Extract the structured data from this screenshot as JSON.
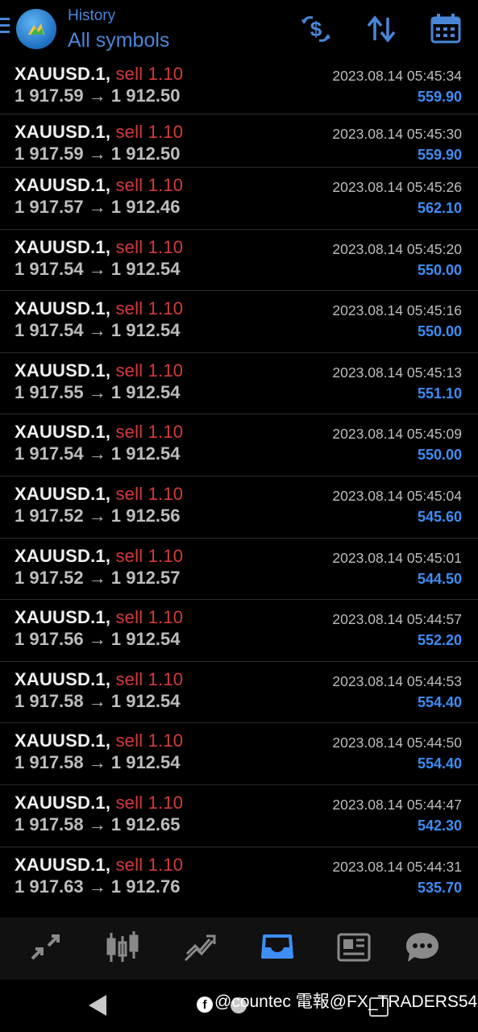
{
  "header": {
    "title": "History",
    "subtitle": "All symbols",
    "icons": [
      "menu-icon",
      "metatrader-logo-icon",
      "dollar-refresh-icon",
      "sort-arrows-icon",
      "calendar-icon"
    ],
    "accent_color": "#4a86d8"
  },
  "colors": {
    "sell": "#d63a3a",
    "profit": "#3d8ef5",
    "text": "#f2f2f2",
    "muted": "#bdbdbd"
  },
  "trades": [
    {
      "symbol": "XAUUSD.1,",
      "side": "sell 1.10",
      "prices": "1 917.59 → 1 912.50",
      "time": "2023.08.14 05:45:34",
      "profit": "559.90"
    },
    {
      "symbol": "XAUUSD.1,",
      "side": "sell 1.10",
      "prices": "1 917.59 → 1 912.50",
      "time": "2023.08.14 05:45:30",
      "profit": "559.90"
    },
    {
      "symbol": "XAUUSD.1,",
      "side": "sell 1.10",
      "prices": "1 917.57 → 1 912.46",
      "time": "2023.08.14 05:45:26",
      "profit": "562.10"
    },
    {
      "symbol": "XAUUSD.1,",
      "side": "sell 1.10",
      "prices": "1 917.54 → 1 912.54",
      "time": "2023.08.14 05:45:20",
      "profit": "550.00"
    },
    {
      "symbol": "XAUUSD.1,",
      "side": "sell 1.10",
      "prices": "1 917.54 → 1 912.54",
      "time": "2023.08.14 05:45:16",
      "profit": "550.00"
    },
    {
      "symbol": "XAUUSD.1,",
      "side": "sell 1.10",
      "prices": "1 917.55 → 1 912.54",
      "time": "2023.08.14 05:45:13",
      "profit": "551.10"
    },
    {
      "symbol": "XAUUSD.1,",
      "side": "sell 1.10",
      "prices": "1 917.54 → 1 912.54",
      "time": "2023.08.14 05:45:09",
      "profit": "550.00"
    },
    {
      "symbol": "XAUUSD.1,",
      "side": "sell 1.10",
      "prices": "1 917.52 → 1 912.56",
      "time": "2023.08.14 05:45:04",
      "profit": "545.60"
    },
    {
      "symbol": "XAUUSD.1,",
      "side": "sell 1.10",
      "prices": "1 917.52 → 1 912.57",
      "time": "2023.08.14 05:45:01",
      "profit": "544.50"
    },
    {
      "symbol": "XAUUSD.1,",
      "side": "sell 1.10",
      "prices": "1 917.56 → 1 912.54",
      "time": "2023.08.14 05:44:57",
      "profit": "552.20"
    },
    {
      "symbol": "XAUUSD.1,",
      "side": "sell 1.10",
      "prices": "1 917.58 → 1 912.54",
      "time": "2023.08.14 05:44:53",
      "profit": "554.40"
    },
    {
      "symbol": "XAUUSD.1,",
      "side": "sell 1.10",
      "prices": "1 917.58 → 1 912.54",
      "time": "2023.08.14 05:44:50",
      "profit": "554.40"
    },
    {
      "symbol": "XAUUSD.1,",
      "side": "sell 1.10",
      "prices": "1 917.58 → 1 912.65",
      "time": "2023.08.14 05:44:47",
      "profit": "542.30"
    },
    {
      "symbol": "XAUUSD.1,",
      "side": "sell 1.10",
      "prices": "1 917.63 → 1 912.76",
      "time": "2023.08.14 05:44:31",
      "profit": "535.70"
    }
  ],
  "bottom_nav": {
    "items": [
      "quotes-icon",
      "chart-icon",
      "trade-icon",
      "history-icon",
      "news-icon",
      "chat-icon"
    ],
    "active": "history-icon"
  },
  "watermark": {
    "icon_letter": "f",
    "text": "@countec 電報@FX_TRADERS54"
  }
}
